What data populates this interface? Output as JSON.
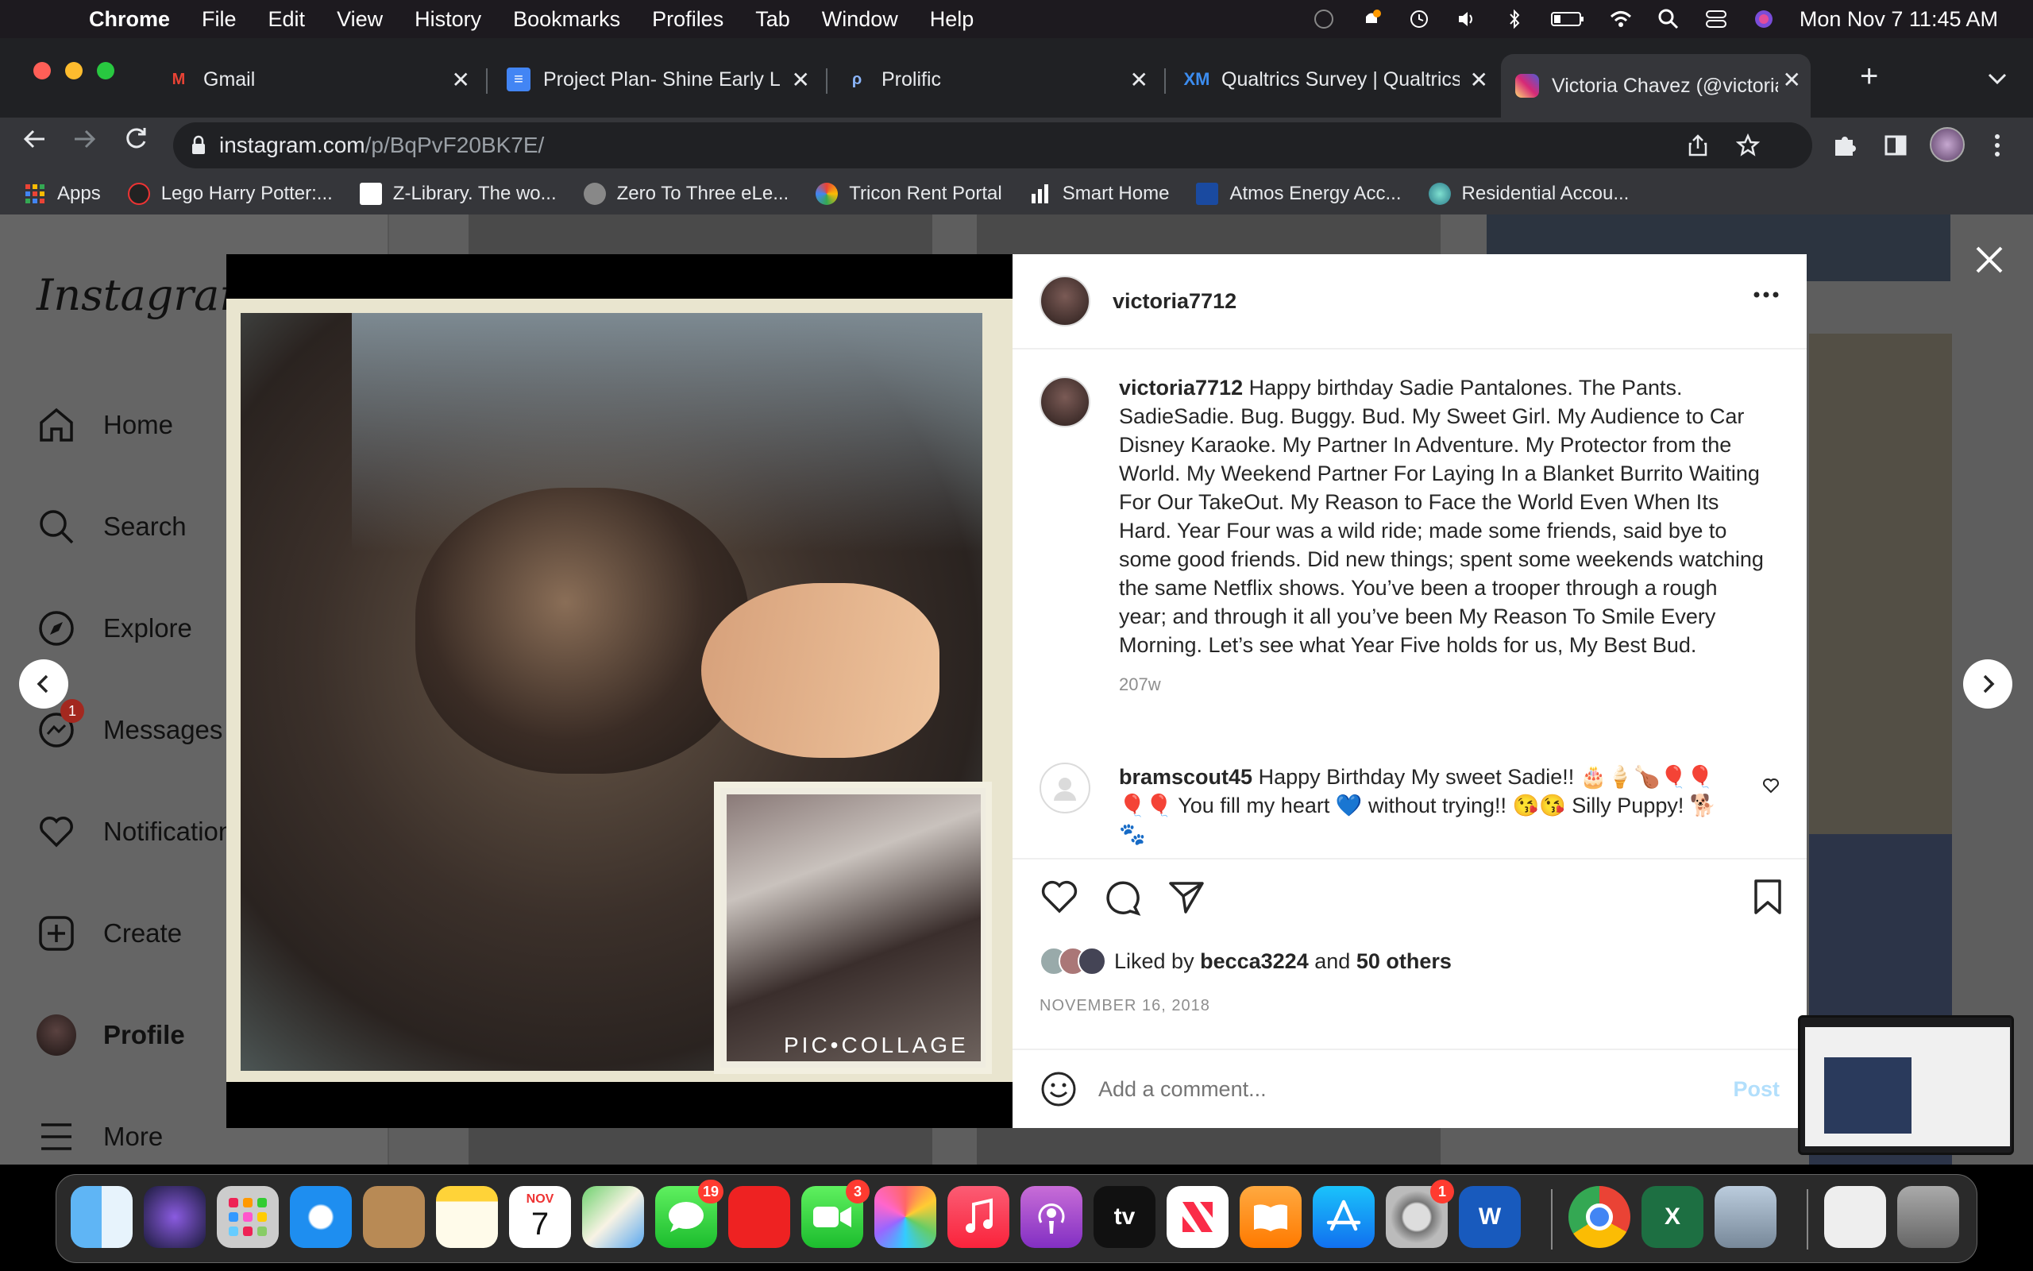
{
  "menubar": {
    "app_name": "Chrome",
    "items": [
      "File",
      "Edit",
      "View",
      "History",
      "Bookmarks",
      "Profiles",
      "Tab",
      "Window",
      "Help"
    ],
    "datetime": "Mon Nov 7  11:45 AM"
  },
  "tabs": [
    {
      "title": "Gmail",
      "icon": "gmail-icon"
    },
    {
      "title": "Project Plan- Shine Early L",
      "icon": "docs-icon"
    },
    {
      "title": "Prolific",
      "icon": "prolific-icon"
    },
    {
      "title": "Qualtrics Survey | Qualtrics",
      "icon": "qualtrics-icon"
    },
    {
      "title": "Victoria Chavez (@victoria",
      "icon": "instagram-icon"
    }
  ],
  "address": {
    "domain": "instagram.com",
    "path": "/p/BqPvF20BK7E/"
  },
  "bookmarks": [
    "Apps",
    "Lego Harry Potter:...",
    "Z-Library. The wo...",
    "Zero To Three eLe...",
    "Tricon Rent Portal",
    "Smart Home",
    "Atmos Energy Acc...",
    "Residential Accou..."
  ],
  "sidebar": {
    "logo": "Instagram",
    "items": [
      {
        "label": "Home",
        "icon": "home-icon"
      },
      {
        "label": "Search",
        "icon": "search-icon"
      },
      {
        "label": "Explore",
        "icon": "explore-icon"
      },
      {
        "label": "Messages",
        "icon": "messages-icon",
        "badge": "1"
      },
      {
        "label": "Notifications",
        "icon": "heart-icon"
      },
      {
        "label": "Create",
        "icon": "create-icon"
      },
      {
        "label": "Profile",
        "icon": "avatar"
      },
      {
        "label": "More",
        "icon": "menu-icon"
      }
    ]
  },
  "post": {
    "username": "victoria7712",
    "caption": "Happy birthday Sadie Pantalones. The Pants. SadieSadie. Bug. Buggy. Bud. My Sweet Girl. My Audience to Car Disney Karaoke. My Partner In Adventure. My Protector from the World. My Weekend Partner For Laying In a Blanket Burrito Waiting For Our TakeOut. My Reason to Face the World Even When Its Hard. Year Four was a wild ride; made some friends, said bye to some good friends. Did new things; spent some weekends watching the same Netflix shows. You’ve been a trooper through a rough year; and through it all you’ve been My Reason To Smile Every Morning. Let’s see what Year Five holds for us, My Best Bud.",
    "caption_age": "207w",
    "watermark": "PIC•COLLAGE",
    "comment": {
      "username": "bramscout45",
      "text": "Happy Birthday My sweet Sadie!! 🎂🍦🍗🎈🎈🎈🎈 You fill my heart 💙 without trying!! 😘😘 Silly Puppy! 🐕🐾"
    },
    "liked_by_prefix": "Liked by",
    "liked_by_user": "becca3224",
    "liked_by_and": "and",
    "liked_by_others": "50 others",
    "date": "NOVEMBER 16, 2018",
    "add_comment_placeholder": "Add a comment...",
    "post_button": "Post"
  },
  "dock": {
    "calendar_month": "NOV",
    "calendar_day": "7",
    "tv_label": "tv",
    "badges": {
      "messages": "19",
      "facetime": "3",
      "settings": "1"
    }
  }
}
